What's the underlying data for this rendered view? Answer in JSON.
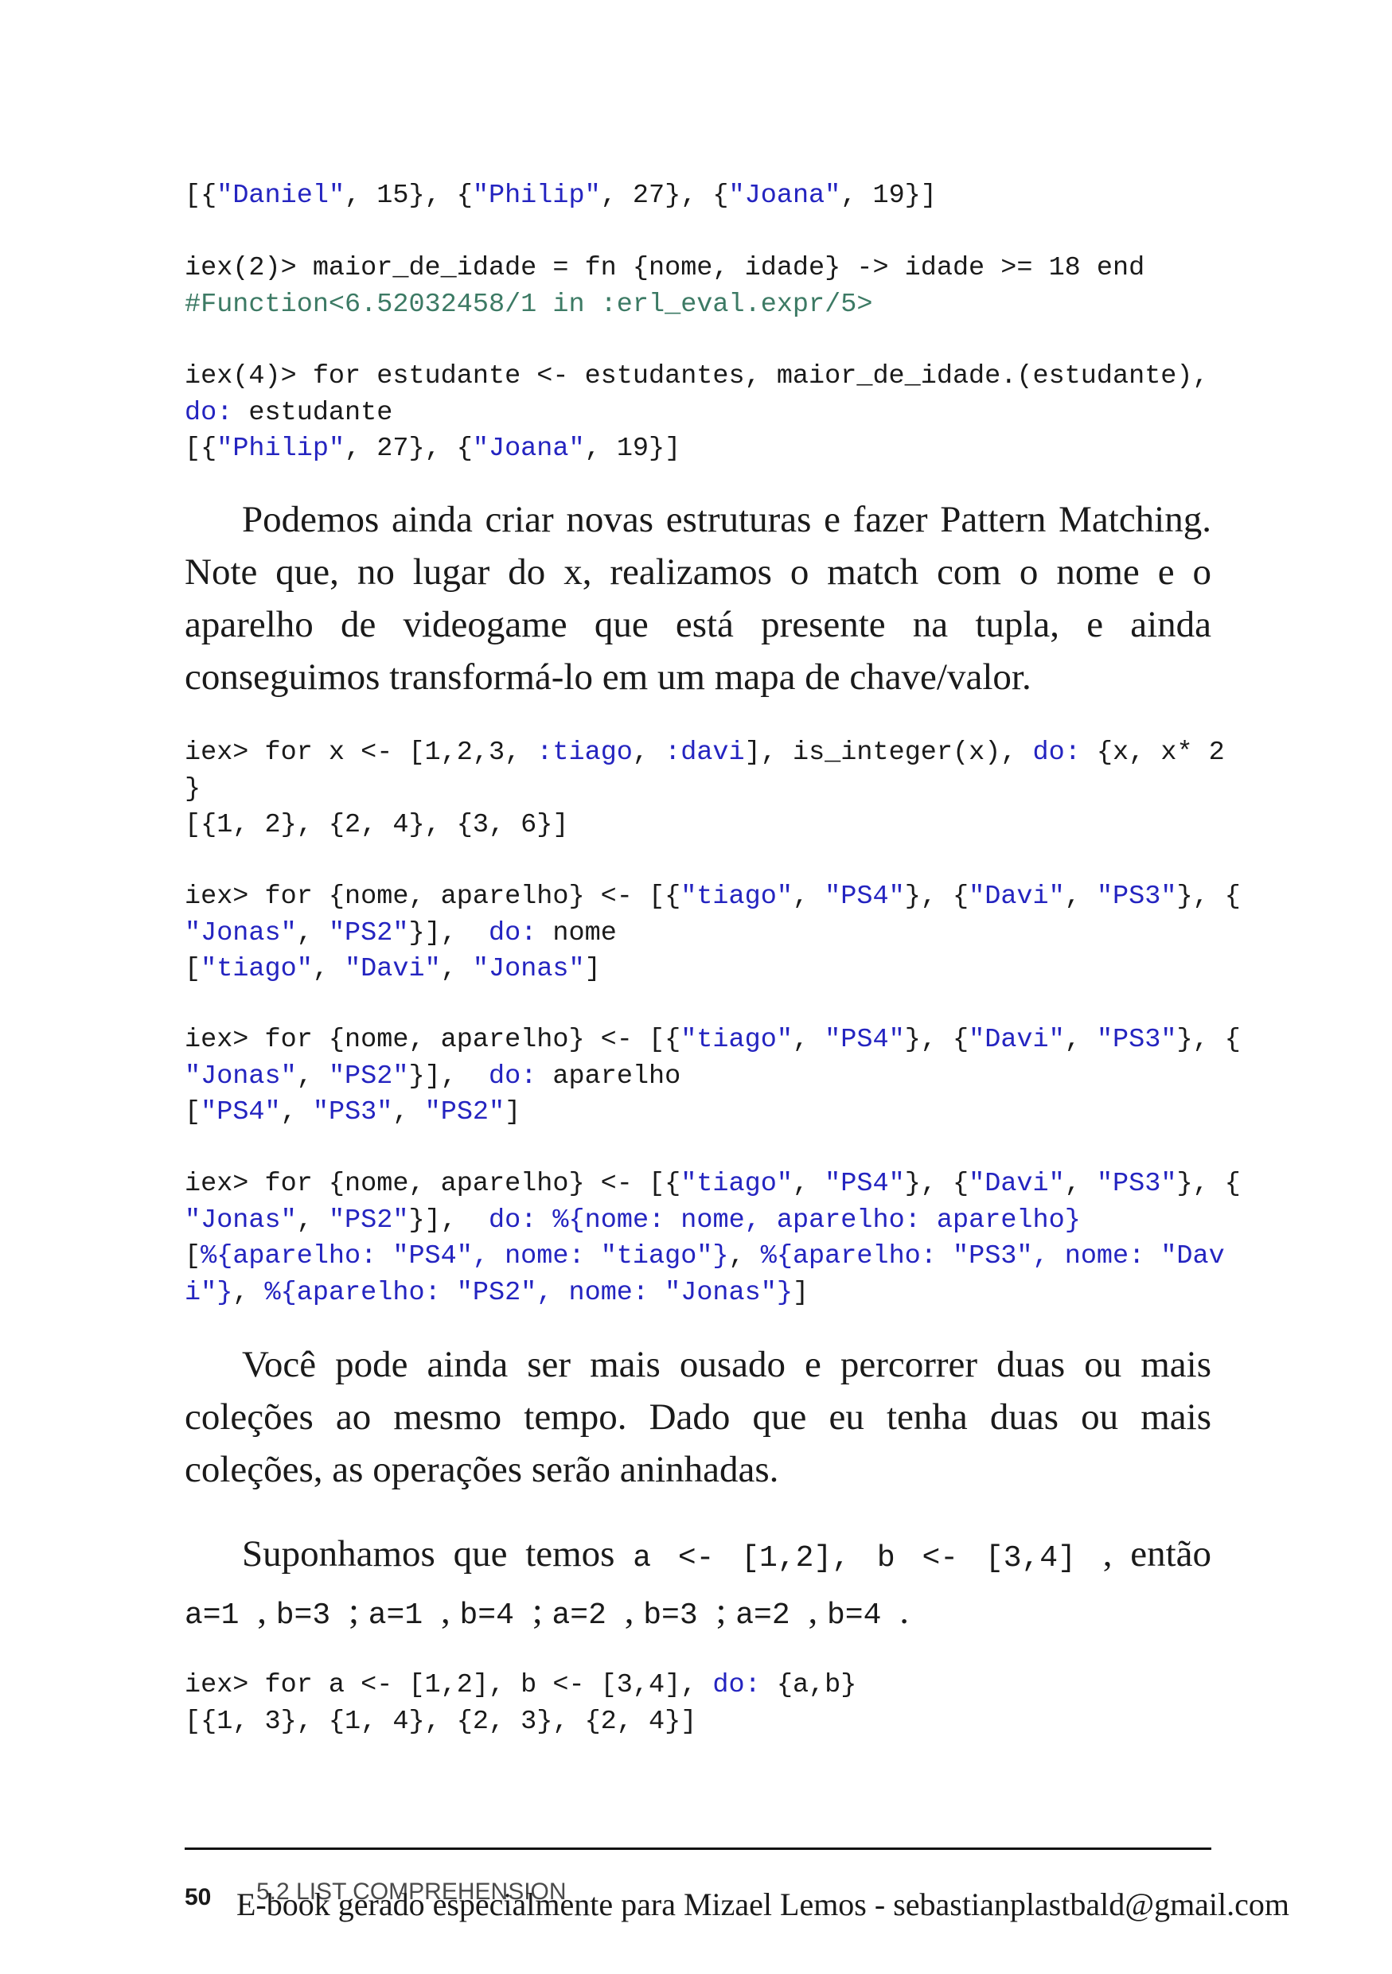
{
  "code_blocks": [
    {
      "lines": [
        [
          [
            "[{",
            ""
          ],
          [
            "\"Daniel\"",
            "s"
          ],
          [
            ", 15}, {",
            ""
          ],
          [
            "\"Philip\"",
            "s"
          ],
          [
            ", 27}, {",
            ""
          ],
          [
            "\"Joana\"",
            "s"
          ],
          [
            ", 19}]",
            ""
          ]
        ]
      ]
    },
    {
      "lines": [
        [
          [
            "iex(2)> maior_de_idade = fn {nome, idade} -> idade >= 18 end",
            ""
          ]
        ],
        [
          [
            "#Function<6.52032458/1 in :erl_eval.expr/5>",
            "c"
          ]
        ]
      ]
    },
    {
      "lines": [
        [
          [
            "iex(4)> for estudante <- estudantes, maior_de_idade.(estudante),",
            ""
          ]
        ],
        [
          [
            "do:",
            "s"
          ],
          [
            " estudante",
            ""
          ]
        ],
        [
          [
            "[{",
            ""
          ],
          [
            "\"Philip\"",
            "s"
          ],
          [
            ", 27}, {",
            ""
          ],
          [
            "\"Joana\"",
            "s"
          ],
          [
            ", 19}]",
            ""
          ]
        ]
      ]
    },
    {
      "lines": [
        [
          [
            "iex> for x <- [1,2,3, ",
            ""
          ],
          [
            ":tiago",
            "s"
          ],
          [
            ", ",
            ""
          ],
          [
            ":davi",
            "s"
          ],
          [
            "], is_integer(x), ",
            ""
          ],
          [
            "do:",
            "s"
          ],
          [
            " {x, x* 2",
            ""
          ]
        ],
        [
          [
            "}",
            ""
          ]
        ],
        [
          [
            "[{1, 2}, {2, 4}, {3, 6}]",
            ""
          ]
        ]
      ]
    },
    {
      "lines": [
        [
          [
            "iex> for {nome, aparelho} <- [{",
            ""
          ],
          [
            "\"tiago\"",
            "s"
          ],
          [
            ", ",
            ""
          ],
          [
            "\"PS4\"",
            "s"
          ],
          [
            "}, {",
            ""
          ],
          [
            "\"Davi\"",
            "s"
          ],
          [
            ", ",
            ""
          ],
          [
            "\"PS3\"",
            "s"
          ],
          [
            "}, {",
            ""
          ]
        ],
        [
          [
            "\"Jonas\"",
            "s"
          ],
          [
            ", ",
            ""
          ],
          [
            "\"PS2\"",
            "s"
          ],
          [
            "}],  ",
            ""
          ],
          [
            "do:",
            "s"
          ],
          [
            " nome",
            ""
          ]
        ],
        [
          [
            "[",
            ""
          ],
          [
            "\"tiago\"",
            "s"
          ],
          [
            ", ",
            ""
          ],
          [
            "\"Davi\"",
            "s"
          ],
          [
            ", ",
            ""
          ],
          [
            "\"Jonas\"",
            "s"
          ],
          [
            "]",
            ""
          ]
        ]
      ]
    },
    {
      "lines": [
        [
          [
            "iex> for {nome, aparelho} <- [{",
            ""
          ],
          [
            "\"tiago\"",
            "s"
          ],
          [
            ", ",
            ""
          ],
          [
            "\"PS4\"",
            "s"
          ],
          [
            "}, {",
            ""
          ],
          [
            "\"Davi\"",
            "s"
          ],
          [
            ", ",
            ""
          ],
          [
            "\"PS3\"",
            "s"
          ],
          [
            "}, {",
            ""
          ]
        ],
        [
          [
            "\"Jonas\"",
            "s"
          ],
          [
            ", ",
            ""
          ],
          [
            "\"PS2\"",
            "s"
          ],
          [
            "}],  ",
            ""
          ],
          [
            "do:",
            "s"
          ],
          [
            " aparelho",
            ""
          ]
        ],
        [
          [
            "[",
            ""
          ],
          [
            "\"PS4\"",
            "s"
          ],
          [
            ", ",
            ""
          ],
          [
            "\"PS3\"",
            "s"
          ],
          [
            ", ",
            ""
          ],
          [
            "\"PS2\"",
            "s"
          ],
          [
            "]",
            ""
          ]
        ]
      ]
    },
    {
      "lines": [
        [
          [
            "iex> for {nome, aparelho} <- [{",
            ""
          ],
          [
            "\"tiago\"",
            "s"
          ],
          [
            ", ",
            ""
          ],
          [
            "\"PS4\"",
            "s"
          ],
          [
            "}, {",
            ""
          ],
          [
            "\"Davi\"",
            "s"
          ],
          [
            ", ",
            ""
          ],
          [
            "\"PS3\"",
            "s"
          ],
          [
            "}, {",
            ""
          ]
        ],
        [
          [
            "\"Jonas\"",
            "s"
          ],
          [
            ", ",
            ""
          ],
          [
            "\"PS2\"",
            "s"
          ],
          [
            "}],  ",
            ""
          ],
          [
            "do: %{nome: nome, aparelho: aparelho}",
            "s"
          ]
        ],
        [
          [
            "[",
            ""
          ],
          [
            "%{aparelho: \"PS4\", nome: \"tiago\"}",
            "s"
          ],
          [
            ", ",
            ""
          ],
          [
            "%{aparelho: \"PS3\", nome: \"Dav",
            "s"
          ]
        ],
        [
          [
            "i\"}",
            "s"
          ],
          [
            ", ",
            ""
          ],
          [
            "%{aparelho: \"PS2\", nome: \"Jonas\"}",
            "s"
          ],
          [
            "]",
            ""
          ]
        ]
      ]
    },
    {
      "lines": [
        [
          [
            "iex> for a <- [1,2], b <- [3,4], ",
            ""
          ],
          [
            "do:",
            "s"
          ],
          [
            " {a,b}",
            ""
          ]
        ],
        [
          [
            "[{1, 3}, {1, 4}, {2, 3}, {2, 4}]",
            ""
          ]
        ]
      ]
    }
  ],
  "paragraphs": [
    {
      "lines": [
        "Podemos ainda criar novas estruturas e fazer Pattern Matching.",
        "Note que, no lugar do x, realizamos o match com o nome e o",
        "aparelho de videogame que está presente na tupla, e ainda",
        "conseguimos transformá-lo em um mapa de chave/valor."
      ]
    },
    {
      "lines": [
        "Você pode ainda ser mais ousado e percorrer duas ou mais",
        "coleções ao mesmo tempo. Dado que eu tenha duas ou mais",
        "coleções, as operações serão aninhadas."
      ]
    },
    {
      "lines": [
        [
          [
            "Suponhamos que temos ",
            ""
          ],
          [
            " a <- [1,2], b <- [3,4] ",
            "m"
          ],
          [
            ", então",
            ""
          ]
        ],
        [
          [
            " a=1 ",
            "m"
          ],
          [
            ", ",
            ""
          ],
          [
            " b=3 ",
            "m"
          ],
          [
            "; ",
            ""
          ],
          [
            " a=1 ",
            "m"
          ],
          [
            ", ",
            ""
          ],
          [
            " b=4 ",
            "m"
          ],
          [
            "; ",
            ""
          ],
          [
            " a=2 ",
            "m"
          ],
          [
            ", ",
            ""
          ],
          [
            " b=3 ",
            "m"
          ],
          [
            "; ",
            ""
          ],
          [
            " a=2 ",
            "m"
          ],
          [
            ", ",
            ""
          ],
          [
            " b=4 ",
            "m"
          ],
          [
            ".",
            ""
          ]
        ]
      ]
    }
  ],
  "footer": {
    "page_number": "50",
    "running_head": "5.2 LIST COMPREHENSION",
    "watermark": "E-book gerado especialmente para Mizael Lemos - sebastianplastbald@gmail.com"
  }
}
